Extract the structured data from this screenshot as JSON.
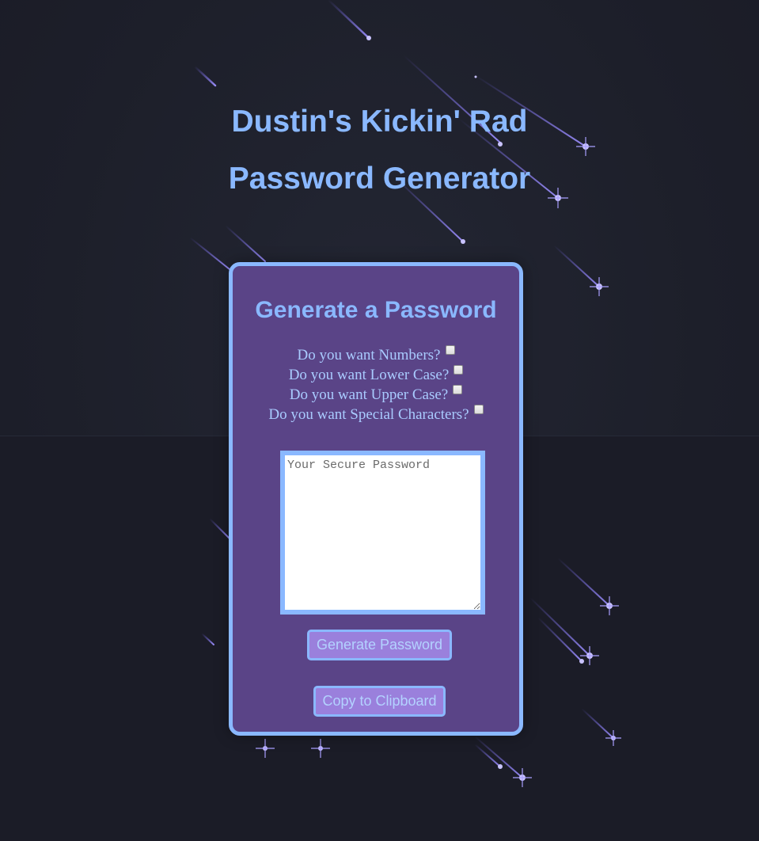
{
  "page": {
    "title_line1": "Dustin's Kickin' Rad",
    "title_line2": "Password Generator"
  },
  "card": {
    "title": "Generate a Password",
    "options": [
      {
        "label": "Do you want Numbers?",
        "checked": false
      },
      {
        "label": "Do you want Lower Case?",
        "checked": false
      },
      {
        "label": "Do you want Upper Case?",
        "checked": false
      },
      {
        "label": "Do you want Special Characters?",
        "checked": false
      }
    ],
    "password_placeholder": "Your Secure Password",
    "password_value": "",
    "generate_label": "Generate Password",
    "copy_label": "Copy to Clipboard"
  },
  "colors": {
    "background": "#1d1f2a",
    "accent": "#8ab8ff",
    "card": "#5a4487",
    "button": "#9a80dc",
    "meteor": "#7b6cff"
  }
}
